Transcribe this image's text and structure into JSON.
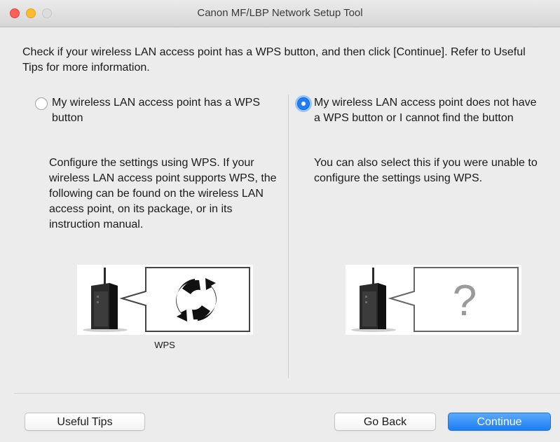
{
  "window": {
    "title": "Canon MF/LBP Network Setup Tool"
  },
  "instruction": "Check if your wireless LAN access point has a WPS button, and then click [Continue]. Refer to Useful Tips for more information.",
  "options": [
    {
      "label": "My wireless LAN access point has a WPS button",
      "description": "Configure the settings using WPS. If your wireless LAN access point supports WPS, the following can be found on the wireless LAN access point, on its package, or in its instruction manual.",
      "illustration_caption": "WPS",
      "selected": false,
      "icon": "wps-icon"
    },
    {
      "label": "My wireless LAN access point does not have a WPS button or I cannot find the button",
      "description": "You can also select this if you were unable to configure the settings using WPS.",
      "illustration_caption": "",
      "selected": true,
      "icon": "question-mark-icon"
    }
  ],
  "buttons": {
    "useful_tips": "Useful Tips",
    "go_back": "Go Back",
    "continue": "Continue"
  },
  "colors": {
    "accent": "#1f7ef5",
    "window_bg": "#ececec"
  }
}
